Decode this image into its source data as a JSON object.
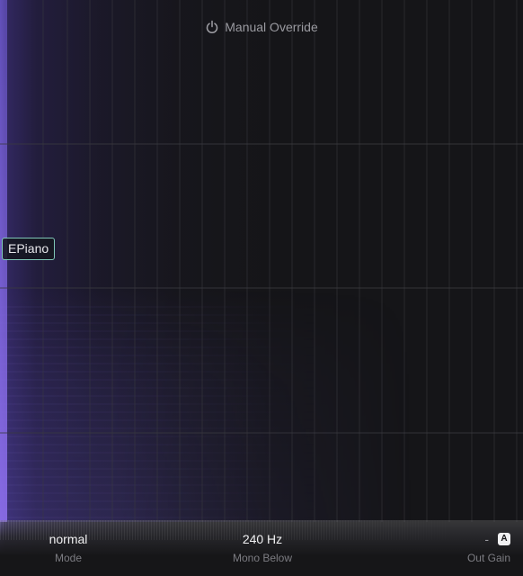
{
  "header": {
    "title": "Manual Override",
    "icon": "power-icon"
  },
  "instrument_tag": {
    "label": "EPiano"
  },
  "params": {
    "mode": {
      "value": "normal",
      "label": "Mode"
    },
    "mono_below": {
      "value": "240 Hz",
      "label": "Mono Below"
    },
    "out_gain": {
      "value": "-",
      "badge": "A",
      "label": "Out Gain"
    }
  },
  "colors": {
    "background": "#151518",
    "spectrum_purple": "#5a46aa",
    "tag_border": "#7ec6b6",
    "grid": "#3a3a40"
  }
}
